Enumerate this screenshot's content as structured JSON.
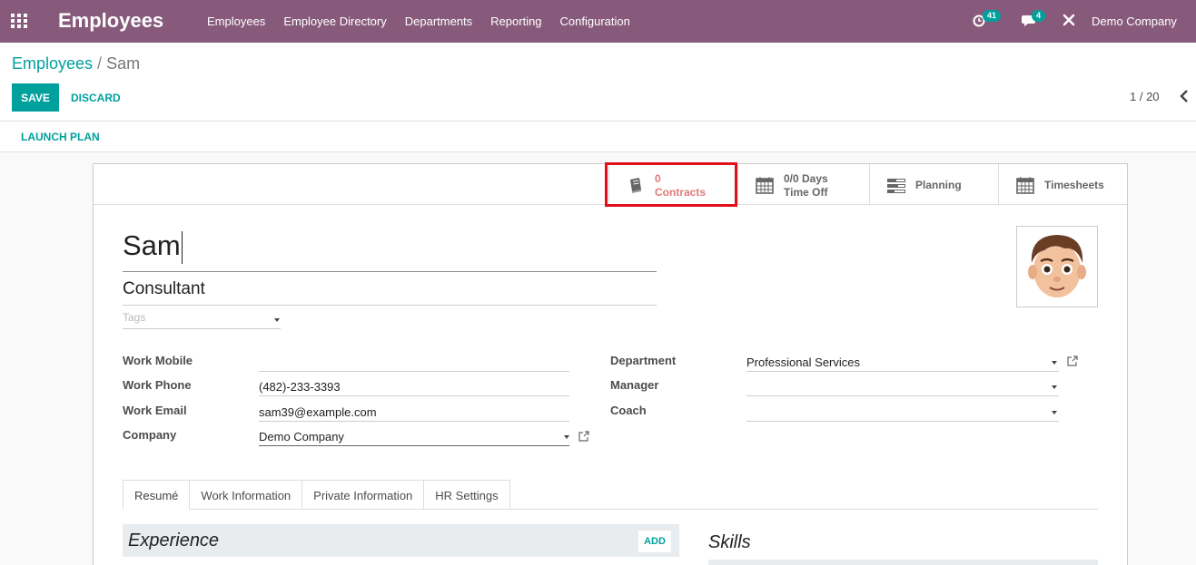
{
  "navbar": {
    "app_title": "Employees",
    "menu": [
      "Employees",
      "Employee Directory",
      "Departments",
      "Reporting",
      "Configuration"
    ],
    "activity_count": "41",
    "messages_count": "4",
    "company": "Demo Company"
  },
  "breadcrumb": {
    "parent": "Employees",
    "separator": "/",
    "current": "Sam"
  },
  "actions": {
    "save": "SAVE",
    "discard": "DISCARD"
  },
  "pager": {
    "value": "1 / 20"
  },
  "statusbar": {
    "launch_plan": "LAUNCH PLAN"
  },
  "smart_buttons": {
    "contracts": {
      "value": "0",
      "label": "Contracts"
    },
    "time_off": {
      "value": "0/0 Days",
      "label": "Time Off"
    },
    "planning": {
      "label": "Planning"
    },
    "timesheets": {
      "label": "Timesheets"
    }
  },
  "employee": {
    "name": "Sam",
    "job_title": "Consultant",
    "tags_placeholder": "Tags"
  },
  "fields": {
    "work_mobile": {
      "label": "Work Mobile",
      "value": ""
    },
    "work_phone": {
      "label": "Work Phone",
      "value": "(482)-233-3393"
    },
    "work_email": {
      "label": "Work Email",
      "value": "sam39@example.com"
    },
    "company": {
      "label": "Company",
      "value": "Demo Company"
    },
    "department": {
      "label": "Department",
      "value": "Professional Services"
    },
    "manager": {
      "label": "Manager",
      "value": ""
    },
    "coach": {
      "label": "Coach",
      "value": ""
    }
  },
  "tabs": [
    "Resumé",
    "Work Information",
    "Private Information",
    "HR Settings"
  ],
  "resume": {
    "experience_title": "Experience",
    "add": "ADD",
    "skills_title": "Skills"
  },
  "colors": {
    "navbar": "#875a7b",
    "accent": "#00a09d",
    "highlight": "#e0101b",
    "contracts_text": "#e07a7a"
  }
}
